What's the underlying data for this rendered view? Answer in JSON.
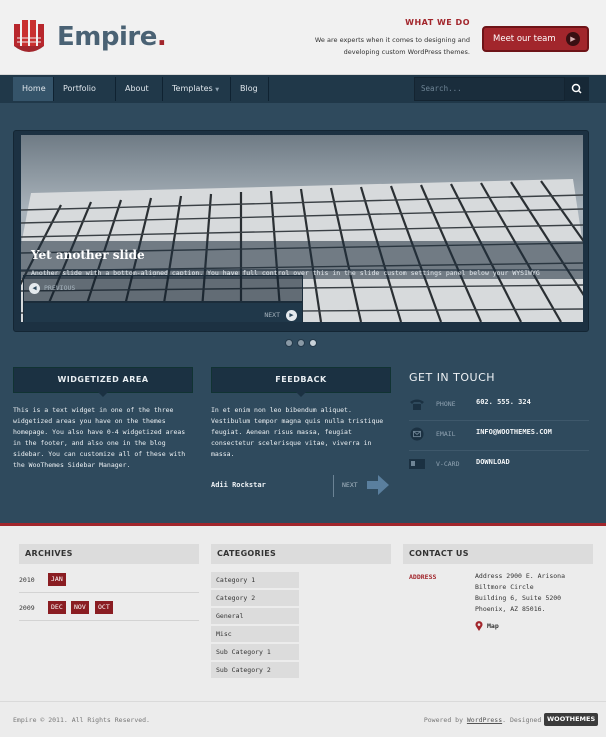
{
  "header": {
    "logo_text": "Empire",
    "logo_dot": ".",
    "what_we_do_title": "WHAT WE DO",
    "what_we_do_text": "We are experts when it comes to designing and developing custom WordPress themes.",
    "cta_label": "Meet our team"
  },
  "nav": {
    "items": [
      {
        "label": "Home",
        "active": true
      },
      {
        "label": "Portfolio"
      },
      {
        "label": "About"
      },
      {
        "label": "Templates",
        "has_dropdown": true
      },
      {
        "label": "Blog"
      }
    ],
    "search_placeholder": "Search..."
  },
  "slider": {
    "title": "Yet another slide",
    "description": "Another slide with a bottom-aligned caption. You have full control over this in the slide custom settings panel below your WYSIWYG",
    "prev_label": "PREVIOUS",
    "next_label": "NEXT",
    "slide_count": 3,
    "active_index": 2
  },
  "widgets": {
    "widgetized": {
      "title": "WIDGETIZED AREA",
      "text": "This is a text widget in one of the three widgetized areas you have on the themes homepage. You also have 0-4 widgetized areas in the footer, and also one in the blog sidebar. You can customize all of these with the WooThemes Sidebar Manager."
    },
    "feedback": {
      "title": "FEEDBACK",
      "text": "In et enim non leo bibendum aliquet. Vestibulum tempor magna quis nulla tristique feugiat. Aenean risus massa, feugiat consectetur scelerisque vitae, viverra in massa.",
      "author": "Adii Rockstar",
      "next_label": "NEXT"
    },
    "get_in_touch": {
      "title": "GET IN TOUCH",
      "rows": [
        {
          "label": "PHONE",
          "value": "602. 555. 324",
          "icon": "phone-icon"
        },
        {
          "label": "EMAIL",
          "value": "INFO@WOOTHEMES.COM",
          "icon": "email-icon"
        },
        {
          "label": "V-CARD",
          "value": "DOWNLOAD",
          "icon": "vcard-icon"
        }
      ]
    }
  },
  "footer": {
    "archives": {
      "title": "ARCHIVES",
      "rows": [
        {
          "year": "2010",
          "months": [
            "JAN"
          ]
        },
        {
          "year": "2009",
          "months": [
            "DEC",
            "NOV",
            "OCT"
          ]
        }
      ]
    },
    "categories": {
      "title": "CATEGORIES",
      "items": [
        "Category 1",
        "Category 2",
        "General",
        "Misc",
        "Sub Category 1",
        "Sub Category 2"
      ]
    },
    "contact": {
      "title": "CONTACT US",
      "address_label": "ADDRESS",
      "address_lines": [
        "Address 2900 E. Arisona",
        "Biltmore Circle",
        "Building 6, Suite 5200",
        "Phoenix, AZ 85016."
      ],
      "map_label": "Map"
    }
  },
  "copyright": {
    "left": "Empire © 2011. All Rights Reserved.",
    "powered_prefix": "Powered by ",
    "powered_link": "WordPress",
    "designed_prefix": ". Designed by",
    "designer_logo": "WOOTHEMES"
  },
  "colors": {
    "accent": "#a2262c",
    "nav_bg": "#203849",
    "main_bg": "#2f4a5d",
    "footer_bg": "#ececec"
  }
}
